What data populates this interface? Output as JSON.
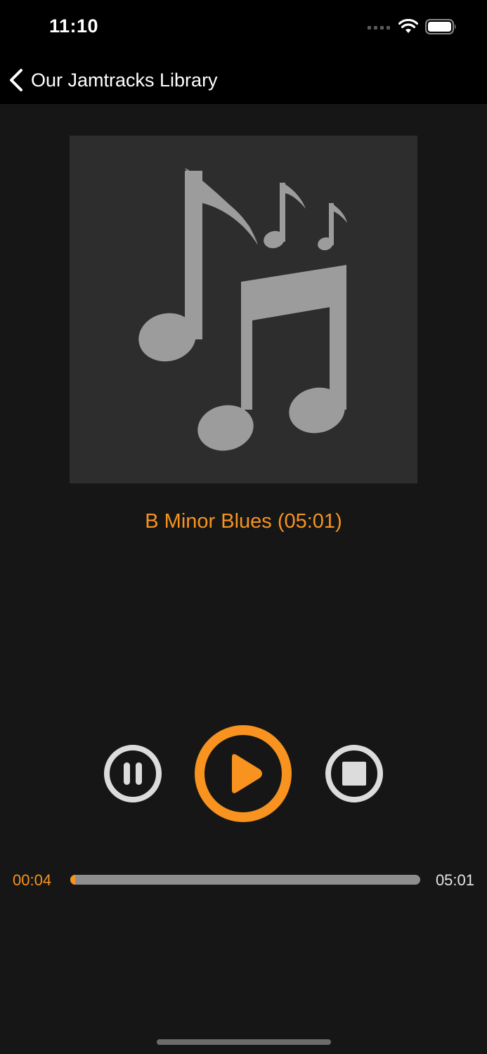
{
  "status_bar": {
    "time": "11:10",
    "icons": [
      "cellular-signal-icon",
      "wifi-icon",
      "battery-icon"
    ]
  },
  "nav": {
    "back_icon": "chevron-left-icon",
    "back_label": "Our Jamtracks Library"
  },
  "player": {
    "artwork_icon": "music-notes-icon",
    "track_title": "B Minor Blues (05:01)",
    "controls": {
      "pause_icon": "pause-icon",
      "play_icon": "play-icon",
      "stop_icon": "stop-icon"
    },
    "elapsed": "00:04",
    "duration": "05:01",
    "progress_fraction": 0.013
  },
  "colors": {
    "accent": "#f7931e",
    "background": "#161616",
    "artwork_bg": "#2d2d2d",
    "control_gray": "#dcdcdc"
  }
}
